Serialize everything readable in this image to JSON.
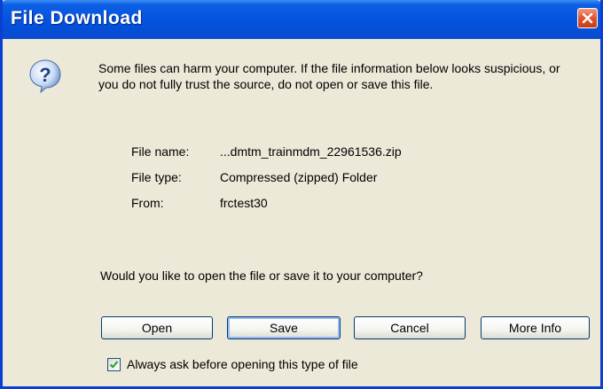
{
  "window": {
    "title": "File Download",
    "close_icon": "close-icon"
  },
  "dialog": {
    "icon": "question-icon",
    "message": "Some files can harm your computer. If the file information below looks suspicious, or you do not fully trust the source, do not open or save this file.",
    "file_info": [
      {
        "label": "File name:",
        "value": "...dmtm_trainmdm_22961536.zip"
      },
      {
        "label": "File type:",
        "value": "Compressed (zipped) Folder"
      },
      {
        "label": "From:",
        "value": "frctest30"
      }
    ],
    "question": "Would you like to open the file or save it to your computer?",
    "buttons": {
      "open": "Open",
      "save": "Save",
      "cancel": "Cancel",
      "more_info": "More Info"
    },
    "checkbox": {
      "label": "Always ask before opening this type of file",
      "checked": true
    }
  },
  "colors": {
    "titlebar": "#0654df",
    "dialog_bg": "#ece9d8",
    "close_button": "#e0532e"
  }
}
